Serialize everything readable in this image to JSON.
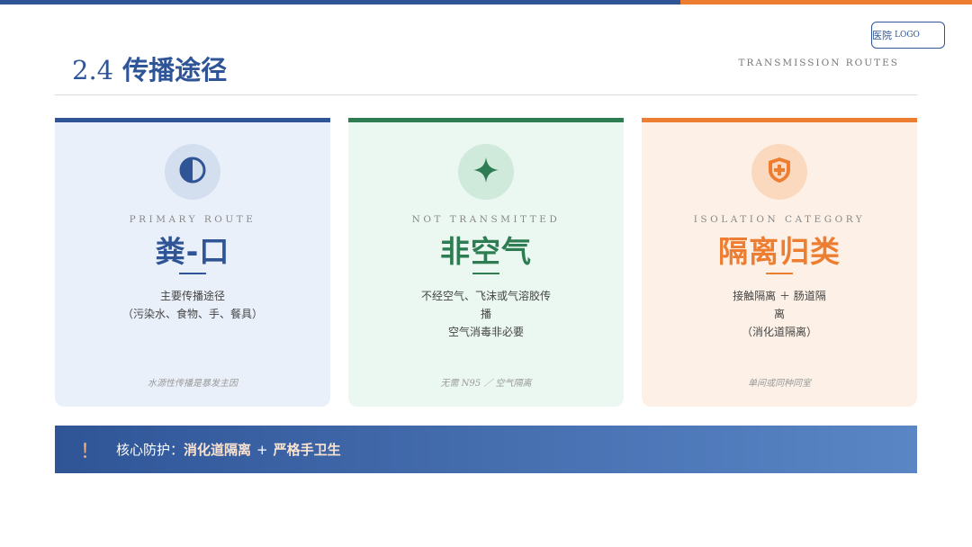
{
  "header": {
    "logo_cn": "医院",
    "logo_en": "LOGO",
    "title_number": "2.4",
    "title_text": "传播途径",
    "subtitle": "TRANSMISSION ROUTES"
  },
  "colors": {
    "blue": "#2f5597",
    "green": "#2e7d52",
    "orange": "#ed7d31"
  },
  "cards": [
    {
      "icon": "half-circle-icon",
      "en_label": "PRIMARY ROUTE",
      "big": "粪-口",
      "desc_1": "主要传播途径",
      "desc_2": "（污染水、食物、手、餐具）",
      "desc_3": "",
      "desc_4": "",
      "note": "水源性传播是暴发主因"
    },
    {
      "icon": "sparkle-icon",
      "en_label": "NOT TRANSMITTED",
      "big": "非空气",
      "desc_1": "不经空气、飞沫或气溶胶传",
      "desc_2": "播",
      "desc_3": "空气消毒非必要",
      "desc_4": "",
      "note": "无需 N95 ／ 空气隔离"
    },
    {
      "icon": "shield-plus-icon",
      "en_label": "ISOLATION CATEGORY",
      "big": "隔离归类",
      "desc_1": "接触隔离 ＋ 肠道隔",
      "desc_2": "离",
      "desc_3": "（消化道隔离）",
      "desc_4": "",
      "note": "单间或同种同室"
    }
  ],
  "banner": {
    "icon": "exclamation-icon",
    "mark": "！",
    "prefix": "核心防护：",
    "item1": "消化道隔离",
    "plus": "+",
    "item2": "严格手卫生"
  }
}
